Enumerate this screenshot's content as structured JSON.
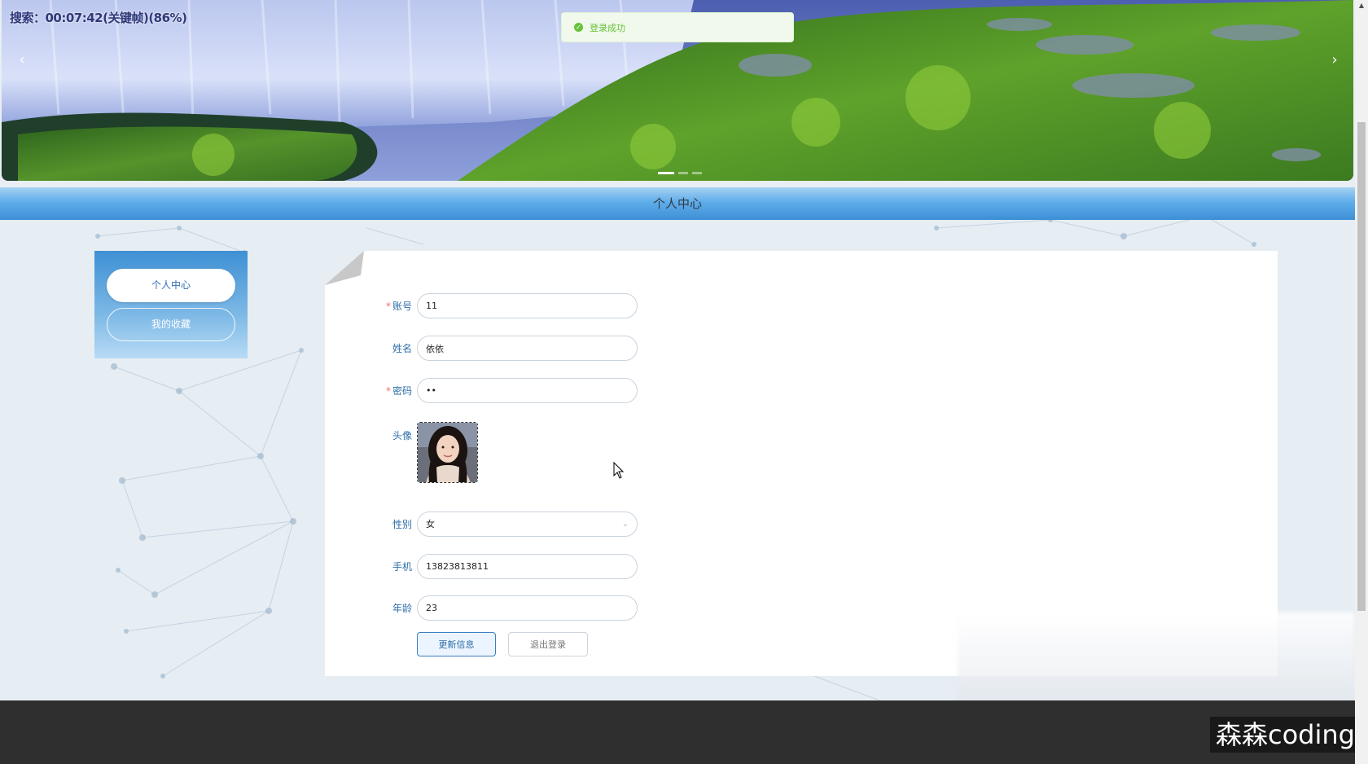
{
  "overlay": {
    "search_status": "搜索：00:07:42(关键帧)(86%)"
  },
  "toast": {
    "icon": "check-circle-icon",
    "message": "登录成功",
    "color": "#67c23a"
  },
  "carousel": {
    "prev_label": "‹",
    "next_label": "›",
    "slide_count": 3,
    "active_index": 0
  },
  "header": {
    "title": "个人中心"
  },
  "sidebar": {
    "items": [
      {
        "label": "个人中心",
        "active": true
      },
      {
        "label": "我的收藏",
        "active": false
      }
    ]
  },
  "form": {
    "fields": {
      "account": {
        "label": "账号",
        "required": true,
        "value": "11"
      },
      "name": {
        "label": "姓名",
        "required": false,
        "value": "依依"
      },
      "password": {
        "label": "密码",
        "required": true,
        "value": "••"
      },
      "avatar": {
        "label": "头像"
      },
      "gender": {
        "label": "性别",
        "value": "女"
      },
      "phone": {
        "label": "手机",
        "value": "13823813811"
      },
      "age": {
        "label": "年龄",
        "value": "23"
      }
    },
    "required_mark": "*",
    "update_button": "更新信息",
    "logout_button": "退出登录"
  },
  "footer": {
    "watermark": "森森coding"
  },
  "colors": {
    "accent": "#3d8fd6",
    "label": "#2e6ea7",
    "required": "#f56c6c",
    "footer": "#2f2f2f"
  }
}
